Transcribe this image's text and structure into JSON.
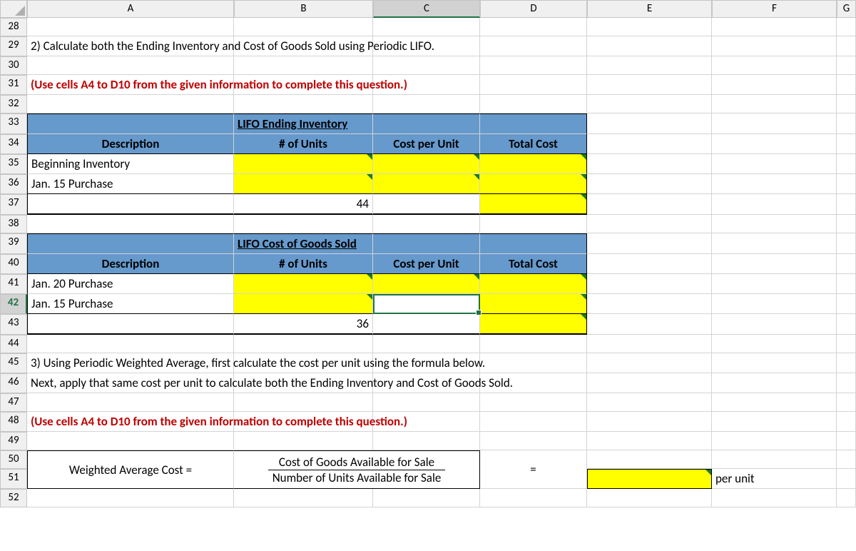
{
  "columns": [
    "A",
    "B",
    "C",
    "D",
    "E",
    "F",
    "G"
  ],
  "rows": [
    "28",
    "29",
    "30",
    "31",
    "32",
    "33",
    "34",
    "35",
    "36",
    "37",
    "38",
    "39",
    "40",
    "41",
    "42",
    "43",
    "44",
    "45",
    "46",
    "47",
    "48",
    "49",
    "50",
    "51",
    "52"
  ],
  "selected_col": "C",
  "selected_row": "42",
  "cells": {
    "A29": "2) Calculate both the Ending Inventory and Cost of Goods Sold using Periodic LIFO.",
    "A31": "(Use cells A4 to D10 from the given information to complete this question.)",
    "B33": "LIFO Ending Inventory",
    "A34": "Description",
    "B34": "# of Units",
    "C34": "Cost per Unit",
    "D34": "Total Cost",
    "A35": "Beginning Inventory",
    "A36": "Jan. 15 Purchase",
    "B37": "44",
    "B39": "LIFO Cost of Goods Sold",
    "A40": "Description",
    "B40": "# of Units",
    "C40": "Cost per Unit",
    "D40": "Total Cost",
    "A41": "Jan. 20 Purchase",
    "A42": "Jan. 15 Purchase",
    "B43": "36",
    "A45": "3) Using Periodic Weighted Average, first calculate the cost per unit using the formula below.",
    "A46": "Next, apply that same cost per unit to calculate both the Ending Inventory and Cost of Goods Sold.",
    "A48": "(Use cells A4 to D10 from the given information to complete this question.)",
    "A50": "Weighted Average Cost  =",
    "frac_top": "Cost of Goods Available for Sale",
    "frac_bot": "Number of Units Available for Sale",
    "D50": "=",
    "F51": "per unit"
  }
}
